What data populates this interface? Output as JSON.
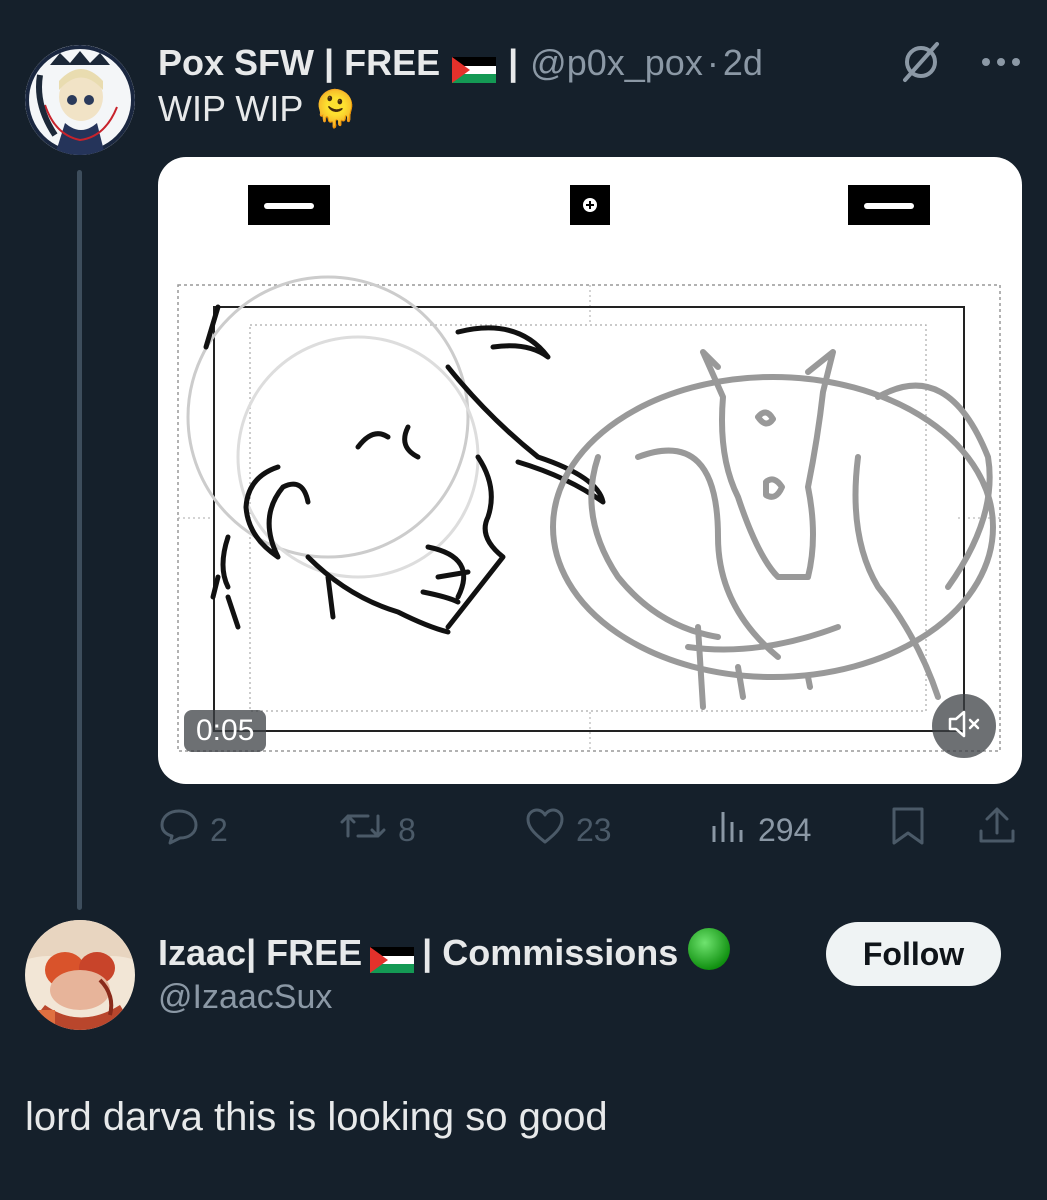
{
  "tweet": {
    "author_name": "Pox SFW | FREE",
    "separator": "|",
    "handle": "@p0x_pox",
    "dot": "·",
    "time_ago": "2d",
    "text": "WIP WIP",
    "emoji": "🫠",
    "video_timestamp": "0:05",
    "actions": {
      "replies": "2",
      "retweets": "8",
      "likes": "23",
      "views": "294"
    }
  },
  "reply": {
    "author_name_part1": "Izaac| FREE",
    "author_name_part2": "| Commissions",
    "handle": "@IzaacSux",
    "follow_label": "Follow",
    "text": "lord darva this is looking so good"
  },
  "colors": {
    "background": "#15202b",
    "text_primary": "#e7e9ea",
    "text_secondary": "#8b98a5",
    "flag_black": "#000000",
    "flag_white": "#ffffff",
    "flag_green": "#149954",
    "flag_red": "#e4312b",
    "status_green": "#1fb51f"
  },
  "icons": [
    "reply-icon",
    "retweet-icon",
    "like-icon",
    "views-icon",
    "bookmark-icon",
    "share-icon",
    "grok-icon",
    "more-icon",
    "mute-icon"
  ]
}
